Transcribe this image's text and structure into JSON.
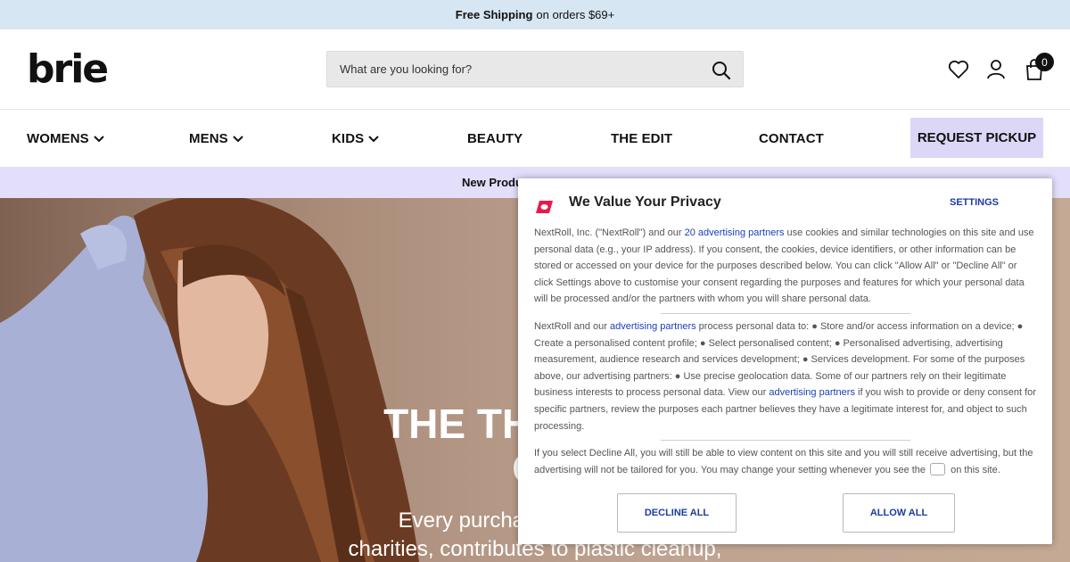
{
  "promo": {
    "bold": "Free Shipping",
    "rest": "on orders $69+"
  },
  "header": {
    "logo": "brie",
    "search_placeholder": "What are you looking for?",
    "cart_count": "0"
  },
  "nav": {
    "items": [
      {
        "label": "WOMENS",
        "has_dropdown": true
      },
      {
        "label": "MENS",
        "has_dropdown": true
      },
      {
        "label": "KIDS",
        "has_dropdown": true
      },
      {
        "label": "BEAUTY",
        "has_dropdown": false
      },
      {
        "label": "THE EDIT",
        "has_dropdown": false
      },
      {
        "label": "CONTACT",
        "has_dropdown": false
      }
    ],
    "cta": "REQUEST PICKUP"
  },
  "sub_bar": {
    "text": "New Produ"
  },
  "hero": {
    "title_line1": "THE THRIFT ST",
    "title_line2": "GO",
    "sub_line1": "Every purchase p",
    "sub_line2": "charities, contributes to plastic cleanup,"
  },
  "privacy": {
    "title": "We Value Your Privacy",
    "settings": "SETTINGS",
    "p1_a": "NextRoll, Inc. (\"NextRoll\") and our ",
    "p1_link": "20 advertising partners",
    "p1_b": " use cookies and similar technologies on this site and use personal data (e.g., your IP address). If you consent, the cookies, device identifiers, or other information can be stored or accessed on your device for the purposes described below. You can click \"Allow All\" or \"Decline All\" or click Settings above to customise your consent regarding the purposes and features for which your personal data will be processed and/or the partners with whom you will share personal data.",
    "p2_a": "NextRoll and our ",
    "p2_link1": "advertising partners",
    "p2_b": " process personal data to: ● Store and/or access information on a device; ● Create a personalised content profile; ● Select personalised content; ● Personalised advertising, advertising measurement, audience research and services development; ● Services development. For some of the purposes above, our advertising partners: ● Use precise geolocation data. Some of our partners rely on their legitimate business interests to process personal data. View our ",
    "p2_link2": "advertising partners",
    "p2_c": " if you wish to provide or deny consent for specific partners, review the purposes each partner believes they have a legitimate interest for, and object to such processing.",
    "p3_a": "If you select Decline All, you will still be able to view content on this site and you will still receive advertising, but the advertising will not be tailored for you. You may change your setting whenever you see the ",
    "p3_b": "on this site.",
    "decline": "DECLINE ALL",
    "allow": "ALLOW ALL"
  },
  "colors": {
    "promo_bg": "#d6e6f3",
    "nav_cta_bg": "#dcd7f7",
    "sub_bar_bg": "#e3def9",
    "link_blue": "#1a3fb8",
    "nextroll_red": "#e8174a"
  },
  "icons": [
    "search-icon",
    "heart-icon",
    "user-icon",
    "cart-icon",
    "chevron-down-icon",
    "nextroll-logo-icon"
  ]
}
